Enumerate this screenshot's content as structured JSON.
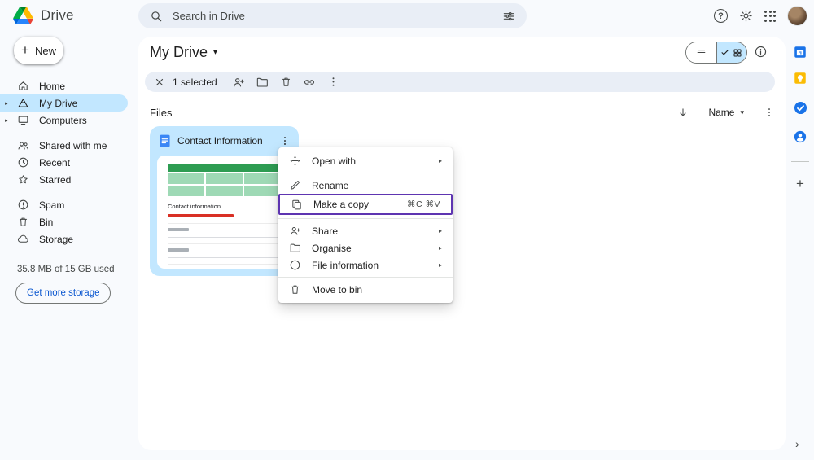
{
  "topbar": {
    "app_name": "Drive",
    "search_placeholder": "Search in Drive"
  },
  "sidebar": {
    "new_label": "New",
    "items": {
      "home": "Home",
      "my_drive": "My Drive",
      "computers": "Computers",
      "shared_with_me": "Shared with me",
      "recent": "Recent",
      "starred": "Starred",
      "spam": "Spam",
      "bin": "Bin",
      "storage": "Storage"
    },
    "storage_used": "35.8 MB of 15 GB used",
    "get_more_storage": "Get more storage"
  },
  "main": {
    "title": "My Drive",
    "selected_count": "1 selected",
    "files_label": "Files",
    "sort_label": "Name",
    "file_card": {
      "title": "Contact Information",
      "preview_heading": "Contact information"
    }
  },
  "context_menu": {
    "open_with": "Open with",
    "rename": "Rename",
    "make_a_copy": "Make a copy",
    "make_a_copy_shortcut": "⌘C ⌘V",
    "share": "Share",
    "organise": "Organise",
    "file_information": "File information",
    "move_to_bin": "Move to bin"
  },
  "glyphs": {
    "help": "?",
    "caret_down": "▾",
    "submenu_arrow": "▸",
    "tree_arrow": "▸",
    "plus": "+",
    "chevron_right": "›"
  },
  "colors": {
    "selection_blue": "#c2e7ff",
    "accent_blue": "#0b57d0",
    "menu_highlight_purple": "#5e35b1"
  }
}
